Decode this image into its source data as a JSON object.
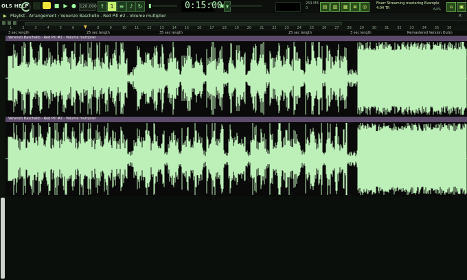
{
  "menu": {
    "label": "OLS HELP"
  },
  "transport": {
    "tempo": "120.000",
    "pattern_number": "1",
    "time": "0:15:00",
    "time_sub": "M:S:CS"
  },
  "system": {
    "memory": "259 MB",
    "cpu": "0"
  },
  "hint": {
    "line1": "Fiverr Streaming mastering Example",
    "line2": "4:04 TR"
  },
  "cpu_pct": "64%",
  "playlist": {
    "arrow": "▶",
    "title": "Playlist - Arrangement › Venenzo Baschello - Red Pill #2 - Volume multiplier",
    "close": "✕"
  },
  "ruler": {
    "numbers": [
      "1",
      "2",
      "3",
      "4",
      "5",
      "6",
      "7",
      "8",
      "9",
      "10",
      "11",
      "12",
      "13",
      "14",
      "15",
      "16",
      "17",
      "18",
      "19",
      "20",
      "21",
      "22",
      "23",
      "24",
      "25",
      "26",
      "27",
      "28",
      "29",
      "30",
      "31",
      "32",
      "33",
      "34",
      "35",
      "36"
    ]
  },
  "markers": [
    {
      "label": "3 sec length"
    },
    {
      "label": "25 sec length"
    },
    {
      "label": "35 sec length"
    },
    {
      "label": "25 sec length"
    },
    {
      "label": "3 sec length"
    },
    {
      "label": "Remastered Version Outro"
    }
  ],
  "tracks": [
    {
      "title": "Venenzo Baschello - Red Pill #2 - Volume multiplier"
    },
    {
      "title": "Venenzo Baschello - Red Pill #2 - Volume multiplier"
    }
  ],
  "colors": {
    "wave": "#bdf0b8",
    "bg": "#050805",
    "track_header": "#5c4a6a",
    "accent": "#c8f070"
  }
}
